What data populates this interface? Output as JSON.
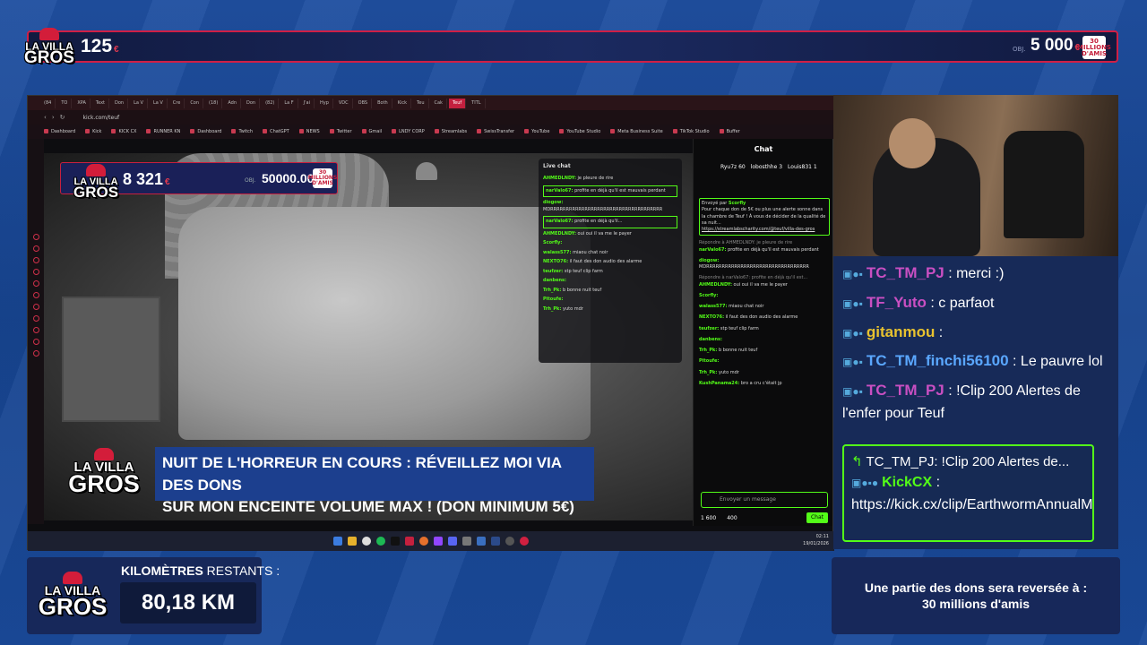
{
  "top_bar": {
    "logo": {
      "line1": "LA VILLA",
      "line2": "GROS"
    },
    "donation_count": "125",
    "currency_symbol": "€",
    "objective_label": "OBJ.",
    "goal": "5 000",
    "badge_text": "30 MILLIONS D'AMIS"
  },
  "browser": {
    "tabs": [
      "(84",
      "TO",
      "XPA",
      "Text",
      "Don",
      "La V",
      "La V",
      "Cre",
      "Con",
      "(18)",
      "Adn",
      "Don",
      "(82)",
      "La F",
      "J'ai",
      "Hyp",
      "VDC",
      "OBS",
      "Both",
      "Kick",
      "Teu",
      "Cak",
      "Teuf",
      "TITL"
    ],
    "active_tab_index": 22,
    "url": "kick.com/teuf",
    "bookmarks": [
      "Dashboard",
      "Kick",
      "KICK CX",
      "RUNNER KN",
      "Dashboard",
      "Twitch",
      "ChatGPT",
      "NEWS",
      "Twitter",
      "Gmail",
      "LNDY CORP",
      "Streamlabs",
      "SwissTransfer",
      "YouTube",
      "YouTube Studio",
      "Meta Business Suite",
      "TikTok Studio",
      "Buffer"
    ]
  },
  "stream_overlay": {
    "donation_count": "8 321",
    "currency_symbol": "€",
    "objective_label": "OBJ.",
    "goal": "50000.00",
    "currency_symbol_goal": "€",
    "badge_text": "30 MILLIONS D'AMIS",
    "logo": {
      "line1": "LA VILLA",
      "line2": "GROS"
    },
    "banner_line1": "NUIT DE L'HORREUR EN COURS : RÉVEILLEZ MOI VIA DES DONS",
    "banner_line2": "SUR MON ENCEINTE VOLUME MAX ! (DON MINIMUM 5€)",
    "banner_logo": {
      "line1": "LA VILLA",
      "line2": "GROS"
    }
  },
  "live_chat": {
    "title": "Live chat",
    "messages": [
      {
        "user": "AHMEDLNDY:",
        "text": "je pleure de rire"
      },
      {
        "user": "narValo67:",
        "text": "profite en déjà qu'il est mauvais perdant"
      },
      {
        "user": "diogow:",
        "text": "MDRRRRRRRRRRRRRRRRRRRRRRRRRRRRRRRRRRRR"
      },
      {
        "user": "narValo67:",
        "text": "profite en déjà qu'il..."
      },
      {
        "user": "AHMEDLNDY:",
        "text": "oui oui il va me le payer"
      },
      {
        "user": "Scorfly:",
        "text": ""
      },
      {
        "user": "walass577:",
        "text": "miaou chat noir"
      },
      {
        "user": "NEXTO76:",
        "text": "il faut des don audio des alarme"
      },
      {
        "user": "teufzer:",
        "text": "stp teuf clip farm"
      },
      {
        "user": "danbens:",
        "text": ""
      },
      {
        "user": "Trh_Pk:",
        "text": "b bonne nuit teuf"
      },
      {
        "user": "Pitoufe:",
        "text": ""
      },
      {
        "user": "Trh_Pk:",
        "text": "yuto mdr"
      }
    ]
  },
  "kick_chat": {
    "title": "Chat",
    "top_users": [
      {
        "name": "Ryu7z",
        "count": "60"
      },
      {
        "name": "lobosthhe",
        "count": "3"
      },
      {
        "name": "Louis831",
        "count": "1"
      }
    ],
    "pinned": {
      "sender_label": "Envoyé par",
      "sender": "Scorfly",
      "text": "Pour chaque don de 5€ ou plus une alerte sonne dans la chambre de Teuf ! À vous de décider de la qualité de sa nuit...",
      "link": "https://streamlabscharity.com/@teuf/villa-des-gros"
    },
    "messages": [
      {
        "user": "narValo67:",
        "text": "profite en déjà qu'il est mauvais perdant",
        "reply": "Répondre à AHMEDLNDY: je pleure de rire"
      },
      {
        "user": "diogow:",
        "text": "MDRRRRRRRRRRRRRRRRRRRRRRRRRRRRRRRRR"
      },
      {
        "user": "AHMEDLNDY:",
        "text": "oui oui il va me le payer",
        "reply": "Répondre à narValo67: profite en déjà qu'il est..."
      },
      {
        "user": "Scorfly:",
        "text": ""
      },
      {
        "user": "walass577:",
        "text": "miaou chat noir"
      },
      {
        "user": "NEXTO76:",
        "text": "il faut des don audio des alarme"
      },
      {
        "user": "teufzer:",
        "text": "stp teuf clip farm"
      },
      {
        "user": "danbens:",
        "text": ""
      },
      {
        "user": "Trh_Pk:",
        "text": "b bonne nuit teuf"
      },
      {
        "user": "Pitoufe:",
        "text": ""
      },
      {
        "user": "Trh_Pk:",
        "text": "yuto mdr"
      },
      {
        "user": "KushPanama24:",
        "text": "bro a cru c'était jp"
      }
    ],
    "input_placeholder": "Envoyer un message",
    "balance_1": "1 600",
    "balance_2": "400",
    "send_label": "Chat"
  },
  "taskbar": {
    "time": "02:11",
    "date": "19/01/2026"
  },
  "right_chat": {
    "messages": [
      {
        "user": "TC_TM_PJ",
        "text": "merci :)",
        "color": "#c94fc2"
      },
      {
        "user": "TF_Yuto",
        "text": "c parfaot",
        "color": "#c94fc2"
      },
      {
        "user": "gitanmou",
        "text": "",
        "color": "#e8c22f"
      },
      {
        "user": "TC_TM_finchi56100",
        "text": "Le pauvre lol",
        "color": "#5aa7ff"
      },
      {
        "user": "TC_TM_PJ",
        "text": "!Clip 200 Alertes de l'enfer pour Teuf",
        "color": "#c94fc2"
      }
    ],
    "highlight": {
      "reply_to": "TC_TM_PJ:",
      "reply_text": "!Clip 200 Alertes de...",
      "user": "KickCX",
      "text": "https://kick.cx/clip/EarthwormAnnualManatee"
    }
  },
  "km_panel": {
    "logo": {
      "line1": "LA VILLA",
      "line2": "GROS"
    },
    "label_bold": "KILOMÈTRES",
    "label_rest": " RESTANTS :",
    "value": "80,18 KM"
  },
  "don_panel": {
    "line1": "Une partie des dons sera reversée à :",
    "line2": "30 millions d'amis"
  }
}
